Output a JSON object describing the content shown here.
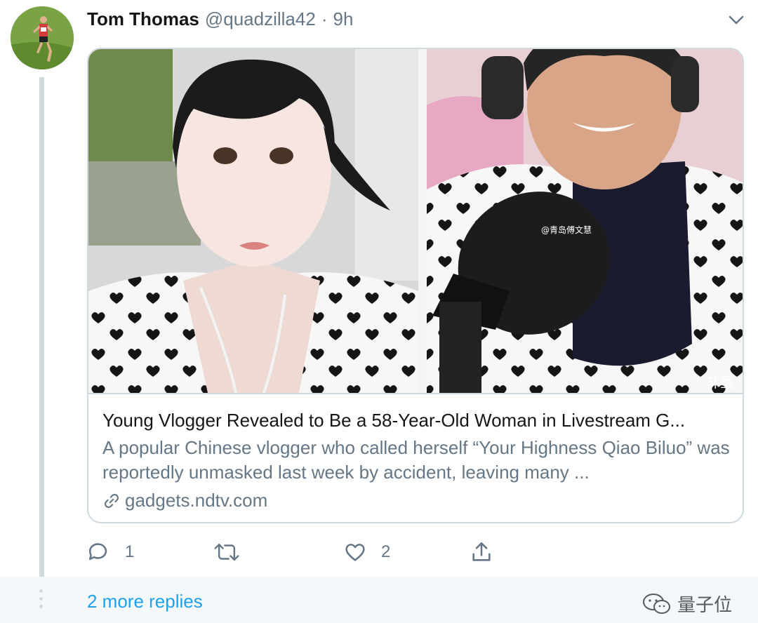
{
  "tweet": {
    "author_name": "Tom Thomas",
    "handle": "@quadzilla42",
    "separator": "·",
    "time": "9h"
  },
  "card": {
    "image_caption_watermark": "@青岛傅文慧",
    "image_corner_logo": "斗鱼",
    "title": "Young Vlogger Revealed to Be a 58-Year-Old Woman in Livestream G...",
    "description": "A popular Chinese vlogger who called herself “Your Highness Qiao Biluo” was reportedly unmasked last week by accident, leaving many ...",
    "domain": "gadgets.ndtv.com"
  },
  "actions": {
    "reply_count": "1",
    "retweet_count": "",
    "like_count": "2"
  },
  "thread": {
    "more_replies": "2 more replies"
  },
  "watermark": {
    "text": "量子位"
  },
  "colors": {
    "link_blue": "#1da1f2",
    "secondary_text": "#657786",
    "border": "#cfd9de",
    "primary_text": "#14171a"
  },
  "icons": {
    "reply": "reply-icon",
    "retweet": "retweet-icon",
    "like": "heart-icon",
    "share": "share-icon",
    "menu": "chevron-down-icon",
    "link": "link-icon"
  }
}
